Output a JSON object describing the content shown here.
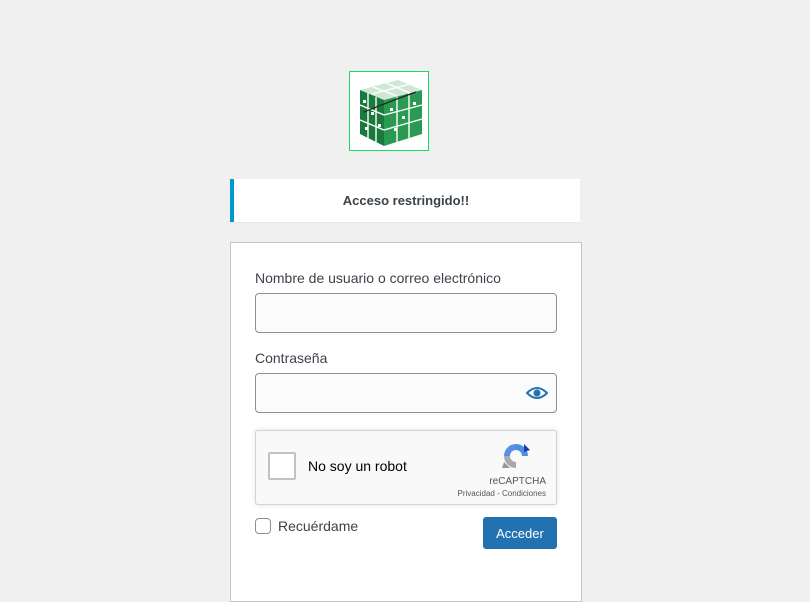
{
  "logo": {
    "icon": "site-logo-cube-icon",
    "colors": {
      "border": "#1ed760",
      "cube_green": "#1a7a3c"
    }
  },
  "notice": {
    "text": "Acceso restringido!!",
    "accent_color": "#0099cc"
  },
  "form": {
    "username_label": "Nombre de usuario o correo electrónico",
    "username_value": "",
    "password_label": "Contraseña",
    "password_value": "",
    "show_password_icon": "eye-icon",
    "recaptcha": {
      "label": "No soy un robot",
      "brand": "reCAPTCHA",
      "privacy_link": "Privacidad",
      "separator": " - ",
      "terms_link": "Condiciones",
      "checked": false
    },
    "remember_label": "Recuérdame",
    "remember_checked": false,
    "submit_label": "Acceder",
    "accent_color": "#2271b1"
  }
}
